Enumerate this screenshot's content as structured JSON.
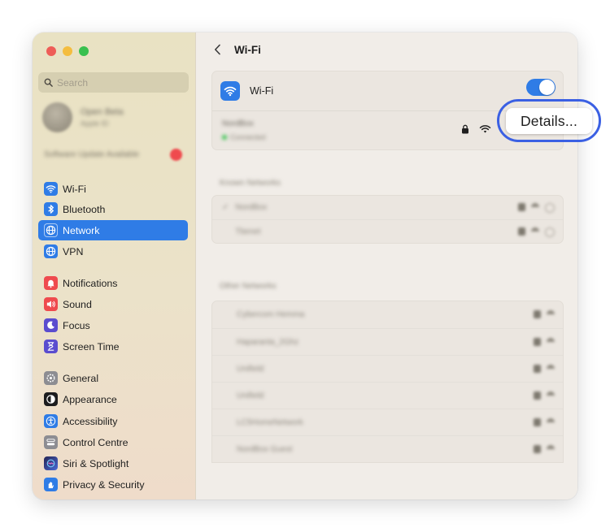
{
  "window": {
    "traffic_lights": {
      "close": "#ee5d57",
      "minimize": "#f4bd3f",
      "zoom": "#39c04f"
    }
  },
  "sidebar": {
    "search_placeholder": "Search",
    "account": {
      "name": "Open Beta",
      "subtitle": "Apple ID"
    },
    "update_notice": "Software Update Available",
    "update_badge": "1",
    "items": [
      {
        "label": "Wi-Fi",
        "icon": "wifi-icon",
        "color": "#2f7ce6"
      },
      {
        "label": "Bluetooth",
        "icon": "bluetooth-icon",
        "color": "#2f7ce6"
      },
      {
        "label": "Network",
        "icon": "globe-icon",
        "color": "#2f7ce6",
        "selected": true
      },
      {
        "label": "VPN",
        "icon": "vpn-globe-icon",
        "color": "#2f7ce6"
      },
      {
        "label": "Notifications",
        "icon": "bell-icon",
        "color": "#ef4a4e"
      },
      {
        "label": "Sound",
        "icon": "speaker-icon",
        "color": "#ef4a4e"
      },
      {
        "label": "Focus",
        "icon": "moon-icon",
        "color": "#5a4ccf"
      },
      {
        "label": "Screen Time",
        "icon": "hourglass-icon",
        "color": "#5a4ccf"
      },
      {
        "label": "General",
        "icon": "gear-icon",
        "color": "#8d8d92"
      },
      {
        "label": "Appearance",
        "icon": "appearance-icon",
        "color": "#1c1c1e"
      },
      {
        "label": "Accessibility",
        "icon": "accessibility-icon",
        "color": "#2f7ce6"
      },
      {
        "label": "Control Centre",
        "icon": "control-centre-icon",
        "color": "#8d8d92"
      },
      {
        "label": "Siri & Spotlight",
        "icon": "siri-icon",
        "color": "#3a3a6a"
      },
      {
        "label": "Privacy & Security",
        "icon": "hand-icon",
        "color": "#2f7ce6"
      }
    ]
  },
  "main": {
    "back_icon": "chevron-left-icon",
    "title": "Wi-Fi",
    "wifi_card": {
      "label": "Wi-Fi",
      "toggle_on": true,
      "current_network": {
        "name": "NordBox",
        "status": "Connected"
      },
      "details_button": "Details..."
    },
    "known_networks": {
      "header": "Known Networks",
      "items": [
        {
          "name": "NordBox",
          "connected": true
        },
        {
          "name": "Tbenet",
          "connected": false
        }
      ]
    },
    "other_networks": {
      "header": "Other Networks",
      "items": [
        {
          "name": "Cybercom Hemma"
        },
        {
          "name": "Haparanta_2Ghz"
        },
        {
          "name": "Unifield"
        },
        {
          "name": "Unifield"
        },
        {
          "name": "LC5HomeNetwork"
        },
        {
          "name": "NordBox Guest"
        }
      ]
    },
    "highlight_color": "#3b60e3"
  }
}
